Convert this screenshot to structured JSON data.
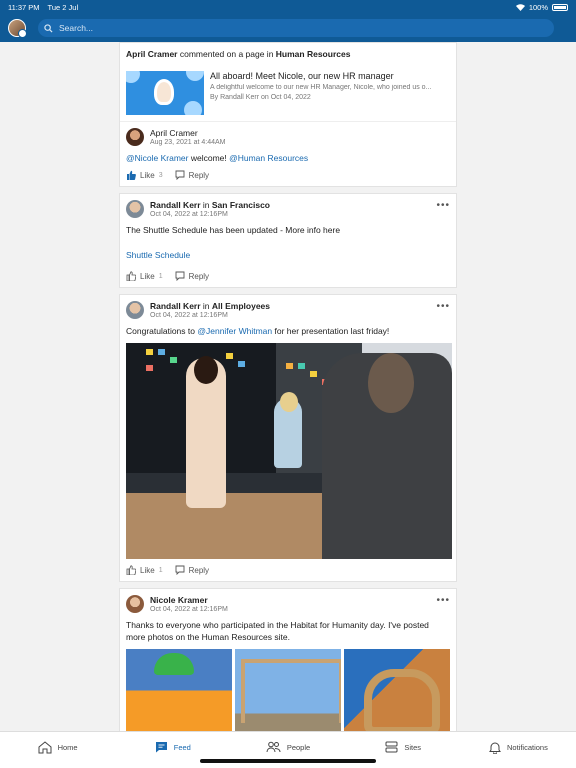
{
  "status": {
    "time": "11:37 PM",
    "date": "Tue 2 Jul",
    "battery": "100%"
  },
  "search": {
    "placeholder": "Search..."
  },
  "posts": [
    {
      "header_actor": "April Cramer",
      "header_mid": " commented on a page in ",
      "header_target": "Human Resources",
      "link_card": {
        "title": "All aboard! Meet Nicole, our new HR manager",
        "desc": "A delightful welcome to our new HR Manager, Nicole, who joined us o...",
        "by": "By Randall Kerr on Oct 04, 2022"
      },
      "comment": {
        "author": "April Cramer",
        "time": "Aug 23, 2021 at 4:44AM",
        "mention1": "@Nicole Kramer",
        "text": " welcome! ",
        "mention2": "@Human Resources",
        "like": "Like",
        "like_count": "3",
        "reply": "Reply"
      }
    },
    {
      "author": "Randall Kerr",
      "in": " in ",
      "group": "San Francisco",
      "time": "Oct 04, 2022 at 12:16PM",
      "text": "The Shuttle Schedule has been updated - More info here",
      "link": "Shuttle Schedule",
      "like": "Like",
      "like_count": "1",
      "reply": "Reply"
    },
    {
      "author": "Randall Kerr",
      "in": " in ",
      "group": "All Employees",
      "time": "Oct 04, 2022 at 12:16PM",
      "text_pre": "Congratulations to ",
      "mention": "@Jennifer Whitman",
      "text_post": " for her presentation last friday!",
      "like": "Like",
      "like_count": "1",
      "reply": "Reply"
    },
    {
      "author": "Nicole Kramer",
      "time": "Oct 04, 2022 at 12:16PM",
      "text": "Thanks to everyone who participated in the Habitat for Humanity day. I've posted more photos on the Human Resources site."
    }
  ],
  "tabs": [
    "Home",
    "Feed",
    "People",
    "Sites",
    "Notifications"
  ],
  "colors": {
    "brand": "#0f5a96",
    "link": "#1a6ab0"
  }
}
